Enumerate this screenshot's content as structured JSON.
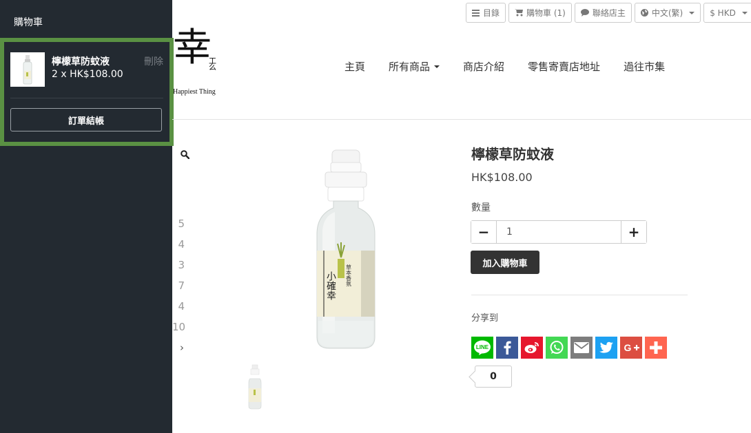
{
  "sidebar": {
    "title": "購物車",
    "cart_item": {
      "name": "檸檬草防蚊液",
      "quantity_price": "2 x  HK$108.00",
      "remove_label": "刪除"
    },
    "checkout_label": "訂單結帳"
  },
  "topbar": {
    "catalog_label": "目錄",
    "cart_label": "購物車 (1)",
    "contact_label": "聯絡店主",
    "language_label": "中文(繁)",
    "currency_label": "$ HKD"
  },
  "logo": {
    "main_char": "幸",
    "small_text": "工\n么",
    "subtitle": "Happiest Thing"
  },
  "nav": {
    "items": [
      "主頁",
      "所有商品",
      "商店介紹",
      "零售寄賣店地址",
      "過往市集"
    ]
  },
  "gallery": {
    "thumb_numbers": [
      "5",
      "4",
      "3",
      "7",
      "4",
      "10"
    ],
    "next_label": "›",
    "bottle_label_big": "小確幸",
    "bottle_label_small": "草本香氛"
  },
  "product": {
    "title": "檸檬草防蚊液",
    "price": "HK$108.00",
    "quantity_label": "數量",
    "quantity_value": "1",
    "minus_label": "−",
    "plus_label": "+",
    "add_to_cart_label": "加入購物車",
    "share_label": "分享到",
    "share_count": "0",
    "share_buttons": [
      {
        "name": "LINE",
        "color": "#00b900",
        "icon": "line-icon"
      },
      {
        "name": "Facebook",
        "color": "#3b5998",
        "icon": "facebook-icon"
      },
      {
        "name": "Weibo",
        "color": "#e6162d",
        "icon": "weibo-icon"
      },
      {
        "name": "WhatsApp",
        "color": "#43d854",
        "icon": "whatsapp-icon"
      },
      {
        "name": "Email",
        "color": "#7d7d7d",
        "icon": "email-icon"
      },
      {
        "name": "Twitter",
        "color": "#1da1f2",
        "icon": "twitter-icon"
      },
      {
        "name": "Google+",
        "color": "#dc4e41",
        "icon": "google-plus-icon"
      },
      {
        "name": "More",
        "color": "#ff6550",
        "icon": "plus-icon"
      }
    ]
  }
}
